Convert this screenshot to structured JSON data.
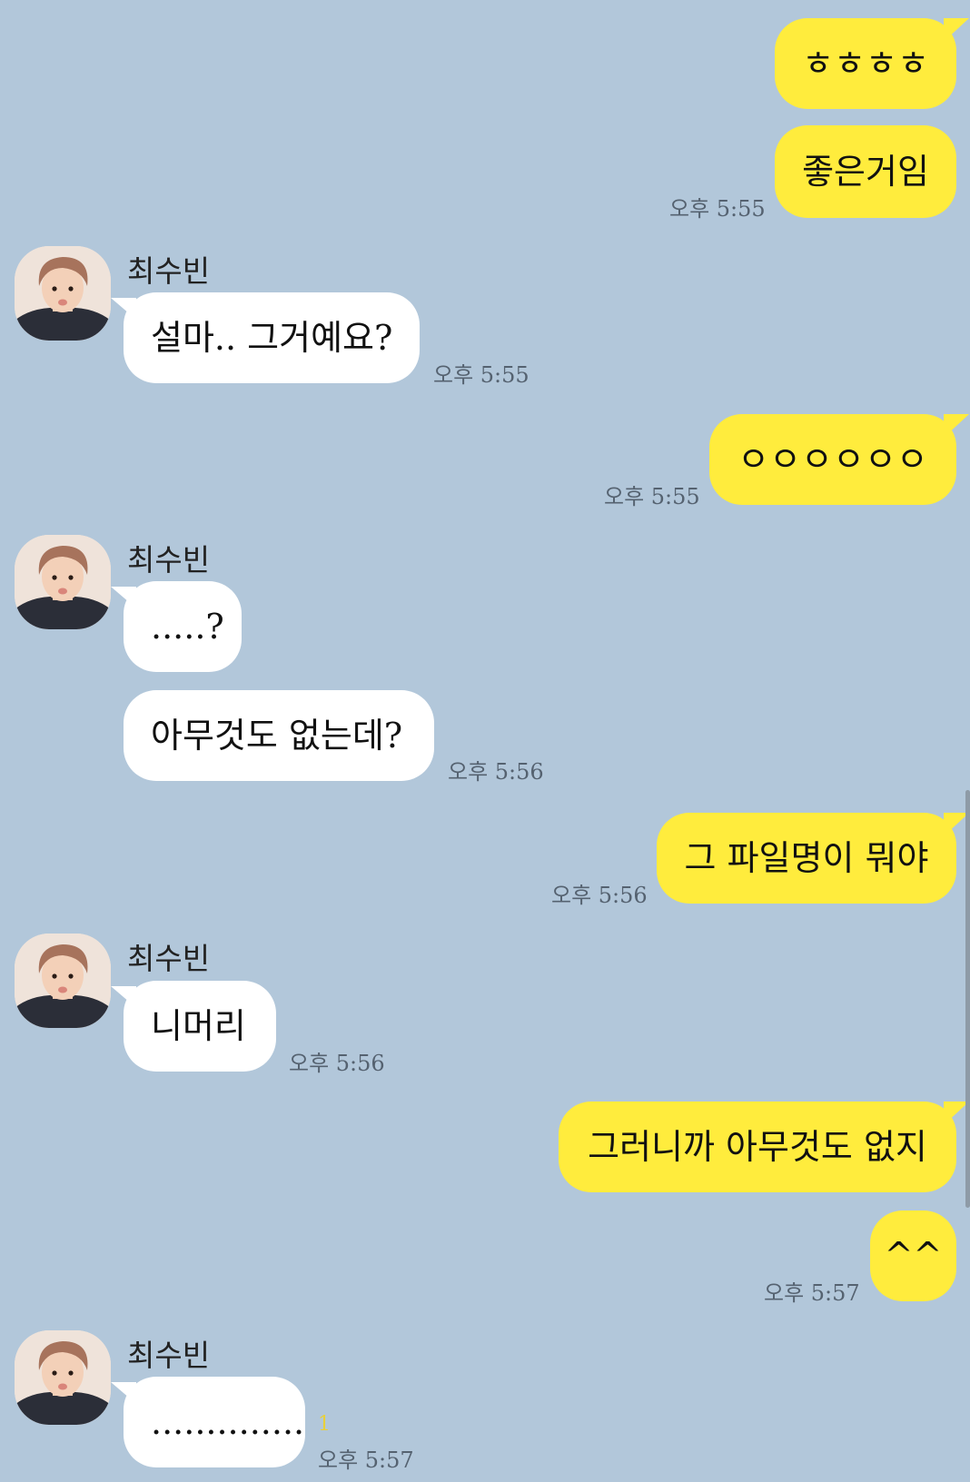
{
  "contact": {
    "name": "최수빈"
  },
  "messages": [
    {
      "text": "ㅎㅎㅎㅎ"
    },
    {
      "text": "좋은거임",
      "time": "오후 5:55"
    },
    {
      "text": "설마.. 그거예요?",
      "time": "오후 5:55"
    },
    {
      "text": "ㅇㅇㅇㅇㅇㅇ",
      "time": "오후 5:55"
    },
    {
      "text": ".....?"
    },
    {
      "text": "아무것도 없는데?",
      "time": "오후 5:56"
    },
    {
      "text": "그 파일명이 뭐야",
      "time": "오후 5:56"
    },
    {
      "text": "니머리",
      "time": "오후 5:56"
    },
    {
      "text": "그러니까 아무것도 없지"
    },
    {
      "text": "^^",
      "time": "오후 5:57"
    },
    {
      "text": "..............",
      "time": "오후 5:57",
      "unread": "1"
    }
  ],
  "colors": {
    "background": "#b2c7da",
    "my_bubble": "#ffec3d",
    "other_bubble": "#ffffff",
    "unread": "#e8d03a"
  }
}
